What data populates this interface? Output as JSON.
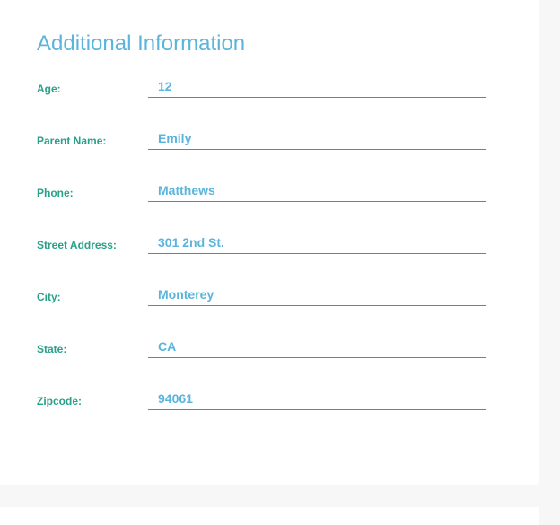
{
  "section": {
    "title": "Additional Information"
  },
  "fields": [
    {
      "label": "Age:",
      "value": "12"
    },
    {
      "label": "Parent Name:",
      "value": "Emily"
    },
    {
      "label": "Phone:",
      "value": "Matthews"
    },
    {
      "label": "Street Address:",
      "value": "301 2nd St."
    },
    {
      "label": "City:",
      "value": "Monterey"
    },
    {
      "label": "State:",
      "value": "CA"
    },
    {
      "label": "Zipcode:",
      "value": "94061"
    }
  ],
  "colors": {
    "title": "#5ab4dc",
    "label": "#2aa089",
    "value": "#5ab4dc",
    "underline": "#7d7d7d",
    "background": "#f7f7f7",
    "card": "#ffffff"
  }
}
